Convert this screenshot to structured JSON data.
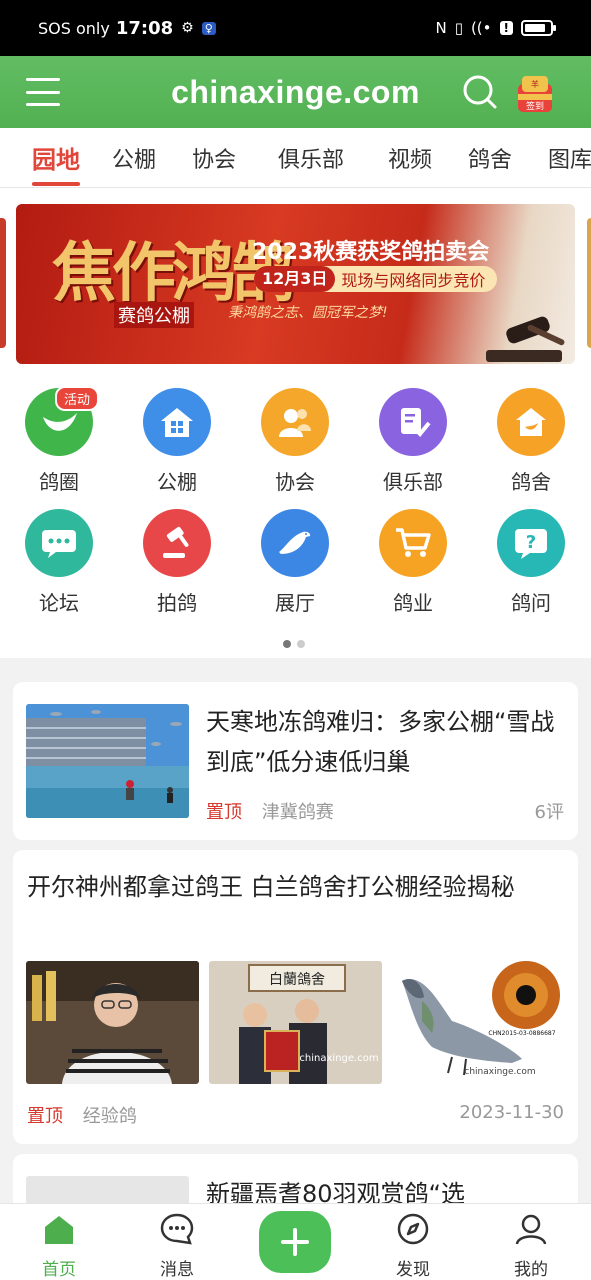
{
  "status_bar": {
    "carrier": "SOS only",
    "time": "17:08"
  },
  "header": {
    "site_title": "chinaxinge.com",
    "checkin_label": "签到",
    "checkin_small": "羊"
  },
  "tabs": [
    {
      "label": "园地",
      "active": true
    },
    {
      "label": "公棚"
    },
    {
      "label": "协会"
    },
    {
      "label": "俱乐部"
    },
    {
      "label": "视频"
    },
    {
      "label": "鸽舍"
    },
    {
      "label": "图库"
    }
  ],
  "banner": {
    "left_title": "焦作鸿鹄",
    "left_subtitle": "赛鸽公棚",
    "right_title": "2023秋赛获奖鸽拍卖会",
    "date": "12月3日",
    "date_note": "现场与网络同步竞价",
    "slogan": "秉鸿鹄之志、圆冠军之梦!"
  },
  "quick_links": [
    {
      "label": "鸽圈",
      "icon": "pigeon-circle-icon",
      "color": "#3fb54a",
      "badge": "活动"
    },
    {
      "label": "公棚",
      "icon": "building-icon",
      "color": "#3f8fe8"
    },
    {
      "label": "协会",
      "icon": "people-icon",
      "color": "#f4a72a"
    },
    {
      "label": "俱乐部",
      "icon": "club-icon",
      "color": "#8a63e0"
    },
    {
      "label": "鸽舍",
      "icon": "loft-icon",
      "color": "#f6a227"
    },
    {
      "label": "论坛",
      "icon": "forum-icon",
      "color": "#2fb89c"
    },
    {
      "label": "拍鸽",
      "icon": "auction-icon",
      "color": "#e8474a"
    },
    {
      "label": "展厅",
      "icon": "showroom-icon",
      "color": "#3c86e4"
    },
    {
      "label": "鸽业",
      "icon": "cart-icon",
      "color": "#f6a223"
    },
    {
      "label": "鸽问",
      "icon": "question-icon",
      "color": "#27b7b4"
    }
  ],
  "articles": [
    {
      "title": "天寒地冻鸽难归：多家公棚“雪战到底”低分速低归巢",
      "pin": "置顶",
      "category": "津冀鸽赛",
      "comments": "6评"
    },
    {
      "title": "开尔神州都拿过鸽王 白兰鸽舍打公棚经验揭秘",
      "pin": "置顶",
      "category": "经验鸽",
      "date": "2023-11-30",
      "img2_sign": "白蘭鴿舍",
      "watermark": "chinaxinge.com",
      "img3_ring": "CHN2015-03-0886687"
    },
    {
      "title": "新疆焉耆80羽观赏鸽“选"
    }
  ],
  "bottom_nav": [
    {
      "label": "首页",
      "active": true
    },
    {
      "label": "消息"
    },
    {
      "label": "发现"
    },
    {
      "label": "我的"
    }
  ]
}
